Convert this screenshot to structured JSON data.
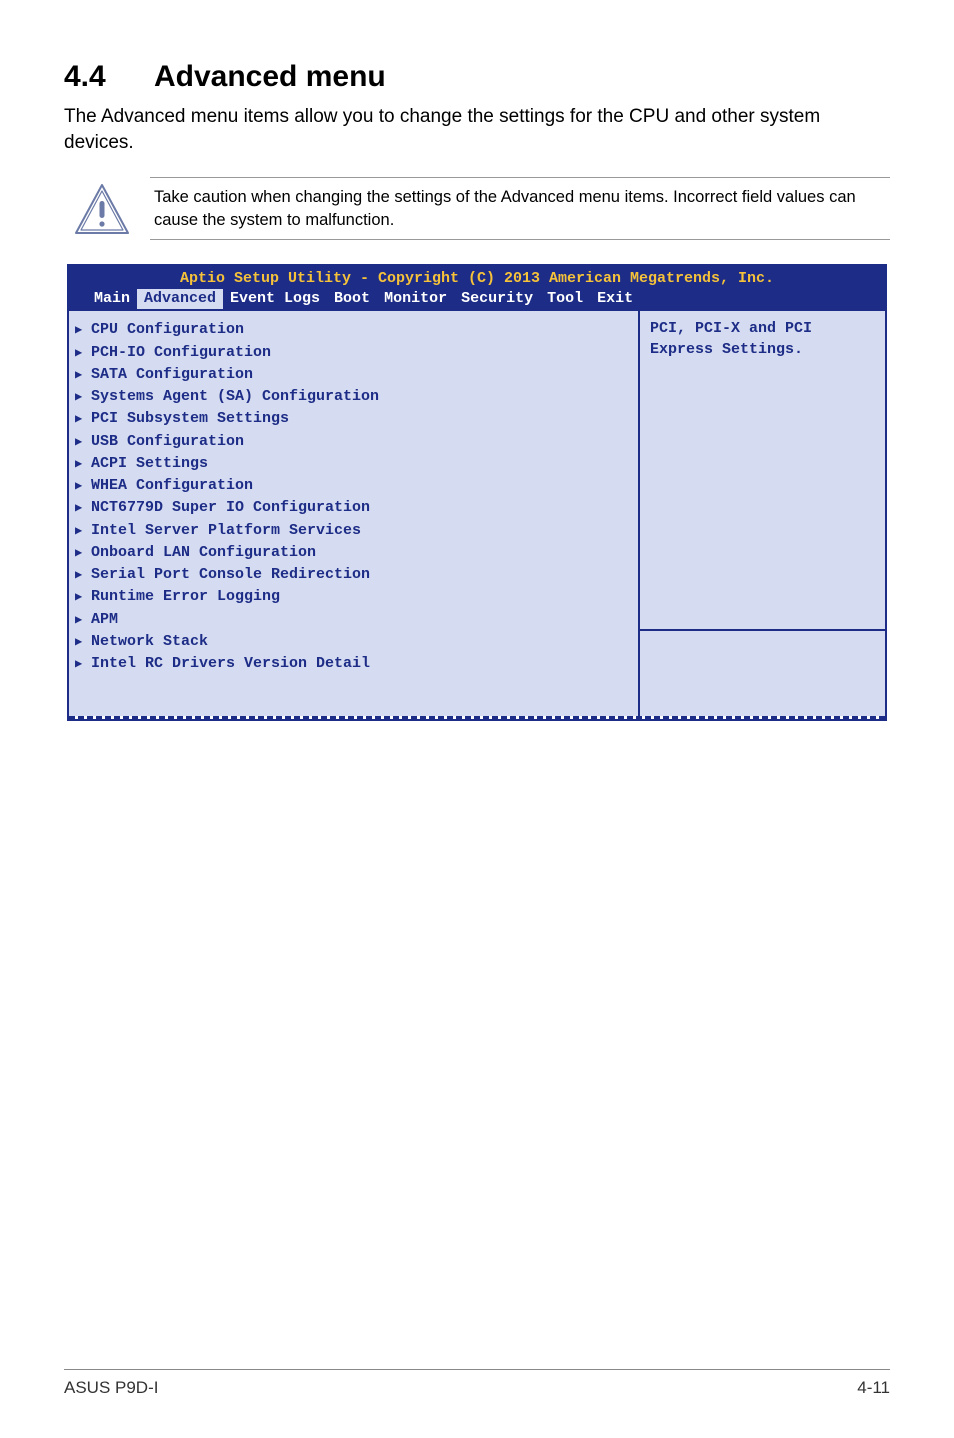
{
  "heading": {
    "number": "4.4",
    "title": "Advanced menu"
  },
  "intro": "The Advanced menu items allow you to change the settings for the CPU and other system devices.",
  "note": "Take caution when changing the settings of the Advanced menu items. Incorrect field values can cause the system to malfunction.",
  "bios": {
    "title": "Aptio Setup Utility - Copyright (C) 2013 American Megatrends, Inc.",
    "tabs": [
      "Main",
      "Advanced",
      "Event Logs",
      "Boot",
      "Monitor",
      "Security",
      "Tool",
      "Exit"
    ],
    "active_tab": "Advanced",
    "items": [
      "CPU Configuration",
      "PCH-IO Configuration",
      "SATA Configuration",
      "Systems Agent (SA) Configuration",
      "PCI Subsystem Settings",
      "USB Configuration",
      "ACPI Settings",
      "WHEA Configuration",
      "NCT6779D Super IO Configuration",
      "Intel Server Platform Services",
      "Onboard LAN Configuration",
      "Serial Port Console Redirection",
      "Runtime Error Logging",
      "APM",
      "Network Stack",
      "Intel RC Drivers Version Detail"
    ],
    "help_line1": "PCI, PCI-X and PCI",
    "help_line2": "Express Settings."
  },
  "footer": {
    "left": "ASUS P9D-I",
    "right": "4-11"
  }
}
